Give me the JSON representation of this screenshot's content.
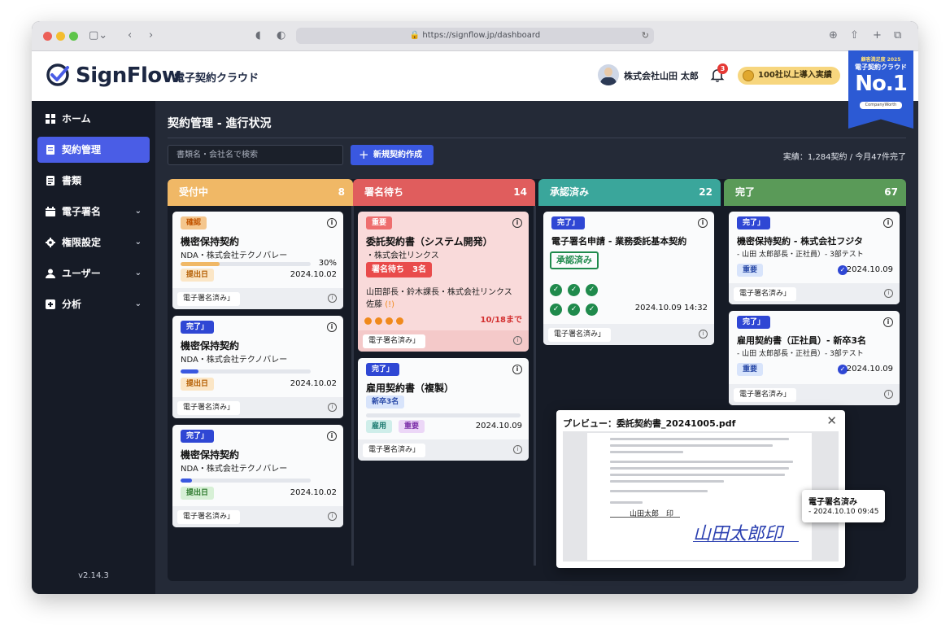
{
  "browser": {
    "url": "https://signflow.jp/dashboard"
  },
  "header": {
    "logo": "SignFlow",
    "subtitle": "電子契約クラウド",
    "user": "株式会社山田 太郎",
    "notification_count": "3",
    "award": "100社以上導入実績",
    "ribbon": {
      "line1": "顧客満足度 2025",
      "line2": "電子契約クラウド",
      "rank": "No.1",
      "source": "CompanyWorth"
    }
  },
  "sidebar": {
    "items": [
      {
        "label": "ホーム"
      },
      {
        "label": "契約管理"
      },
      {
        "label": "書類"
      },
      {
        "label": "電子署名"
      },
      {
        "label": "権限設定"
      },
      {
        "label": "ユーザー"
      },
      {
        "label": "分析"
      }
    ],
    "version": "v2.14.3"
  },
  "main": {
    "title": "契約管理 - 進行状況",
    "search_placeholder": "書類名・会社名で検索",
    "new_button": "新規契約作成",
    "stats": "実績：1,284契約 / 今月47件完了"
  },
  "columns": [
    {
      "label": "受付中",
      "count": "8",
      "color": "#f0b866"
    },
    {
      "label": "署名待ち",
      "count": "14",
      "color": "#e05d5d"
    },
    {
      "label": "承認済み",
      "count": "22",
      "color": "#3aa69b"
    },
    {
      "label": "完了",
      "count": "67",
      "color": "#5a9a58"
    }
  ],
  "cards": {
    "c1": {
      "badge": "確認",
      "title": "機密保持契約",
      "sub": "NDA・株式会社テクノバレー",
      "progress": 0.3,
      "progress_label": "30%",
      "tag": "提出日",
      "date": "2024.10.02",
      "foot": "電子署名済み」"
    },
    "c2": {
      "badge": "完了」",
      "title": "機密保持契約",
      "sub": "NDA・株式会社テクノバレー",
      "progress": 0.14,
      "tag": "提出日",
      "date": "2024.10.02",
      "foot": "電子署名済み」"
    },
    "c3": {
      "badge": "完了」",
      "title": "機密保持契約",
      "sub": "NDA・株式会社テクノバレー",
      "progress": 0.09,
      "tag": "提出日",
      "date": "2024.10.02",
      "foot": "電子署名済み」"
    },
    "c4": {
      "badge": "重要",
      "title": "委託契約書（システム開発）",
      "sub": "・株式会社リンクス",
      "tag": "署名待ち　3名",
      "signers": "山田部長・鈴木課長・株式会社リンクス",
      "signers2": "佐藤",
      "signers2_mark": "(!)",
      "deadline": "10/18まで",
      "foot": "電子署名済み」"
    },
    "c5": {
      "badge": "完了」",
      "title": "雇用契約書（複製）",
      "tag": "新卒3名",
      "tag2": "雇用",
      "tag3": "重要",
      "date": "2024.10.09",
      "foot": "電子署名済み」"
    },
    "c6": {
      "badge": "完了」",
      "title": "電子署名申請 - 業務委託基本契約",
      "stamp": "承認済み",
      "timestamp": "2024.10.09 14:32",
      "foot": "電子署名済み」"
    },
    "c7": {
      "badge": "完了」",
      "title": "機密保持契約 - 株式会社フジタ",
      "sub": "- 山田 太郎部長・正社員）- 3部テスト",
      "tag": "重要",
      "date": "2024.10.09",
      "foot": "電子署名済み」"
    },
    "c8": {
      "badge": "完了」",
      "title": "雇用契約書（正社員）- 新卒3名",
      "sub": "- 山田 太郎部長・正社員）- 3部テスト",
      "tag": "重要",
      "date": "2024.10.09",
      "foot": "電子署名済み」"
    }
  },
  "preview": {
    "title": "プレビュー：委託契約書_20241005.pdf",
    "signer": "山田太郎　印",
    "signature": "山田太郎印"
  },
  "tooltip": {
    "line1": "電子署名済み",
    "line2": "- 2024.10.10 09:45"
  }
}
